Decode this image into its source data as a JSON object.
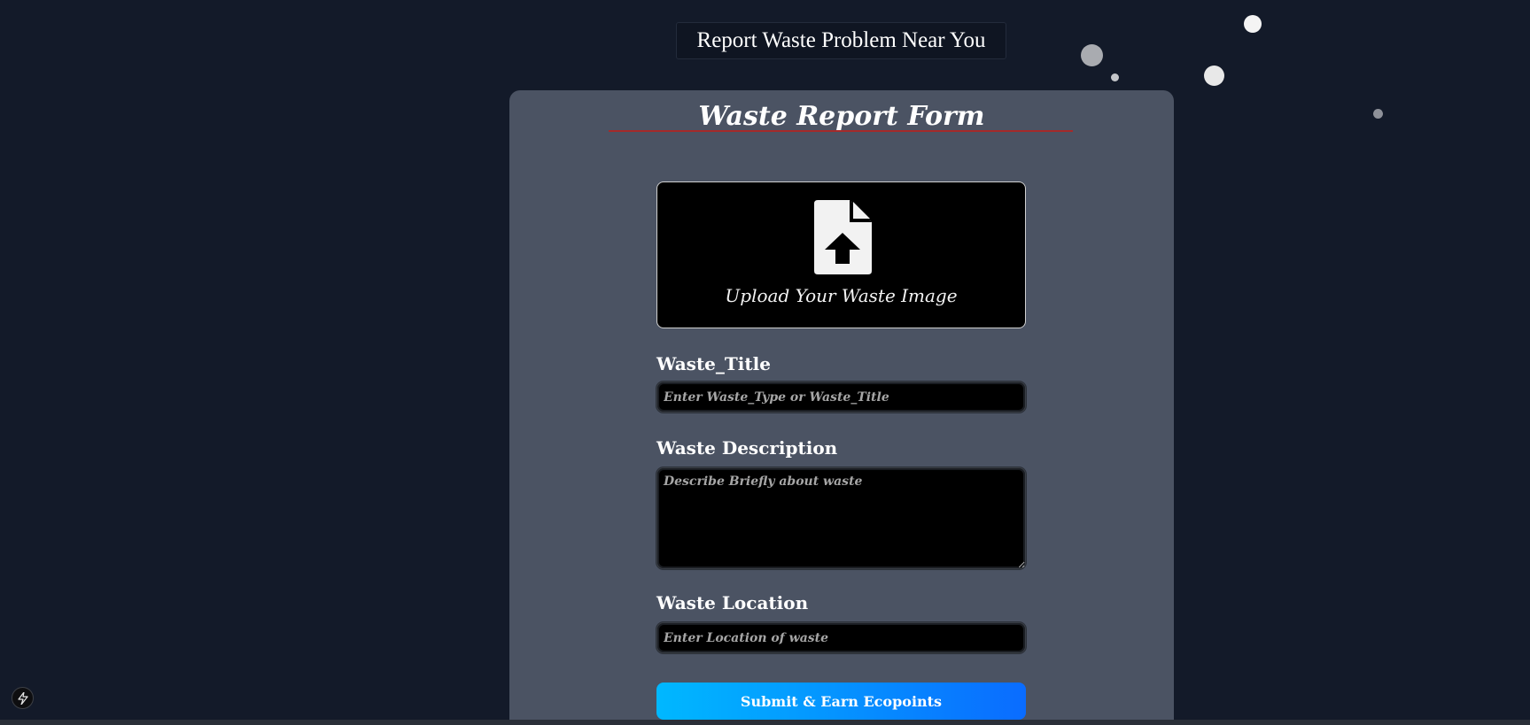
{
  "header": {
    "title": "Report Waste Problem Near You"
  },
  "form": {
    "title": "Waste Report Form",
    "upload": {
      "label": "Upload Your Waste Image",
      "icon": "file-upload-icon"
    },
    "fields": {
      "title": {
        "label": "Waste_Title",
        "placeholder": "Enter Waste_Type or Waste_Title",
        "value": ""
      },
      "description": {
        "label": "Waste Description",
        "placeholder": "Describe Briefly about waste",
        "value": ""
      },
      "location": {
        "label": "Waste Location",
        "placeholder": "Enter Location of waste",
        "value": ""
      }
    },
    "submit_label": "Submit & Earn Ecopoints"
  },
  "corner_badge": {
    "icon": "lightning-icon"
  },
  "colors": {
    "background": "#131a29",
    "card": "#4b5363",
    "underline": "#a52a2a",
    "button_start": "#00b8ff",
    "button_end": "#0a6cff"
  }
}
